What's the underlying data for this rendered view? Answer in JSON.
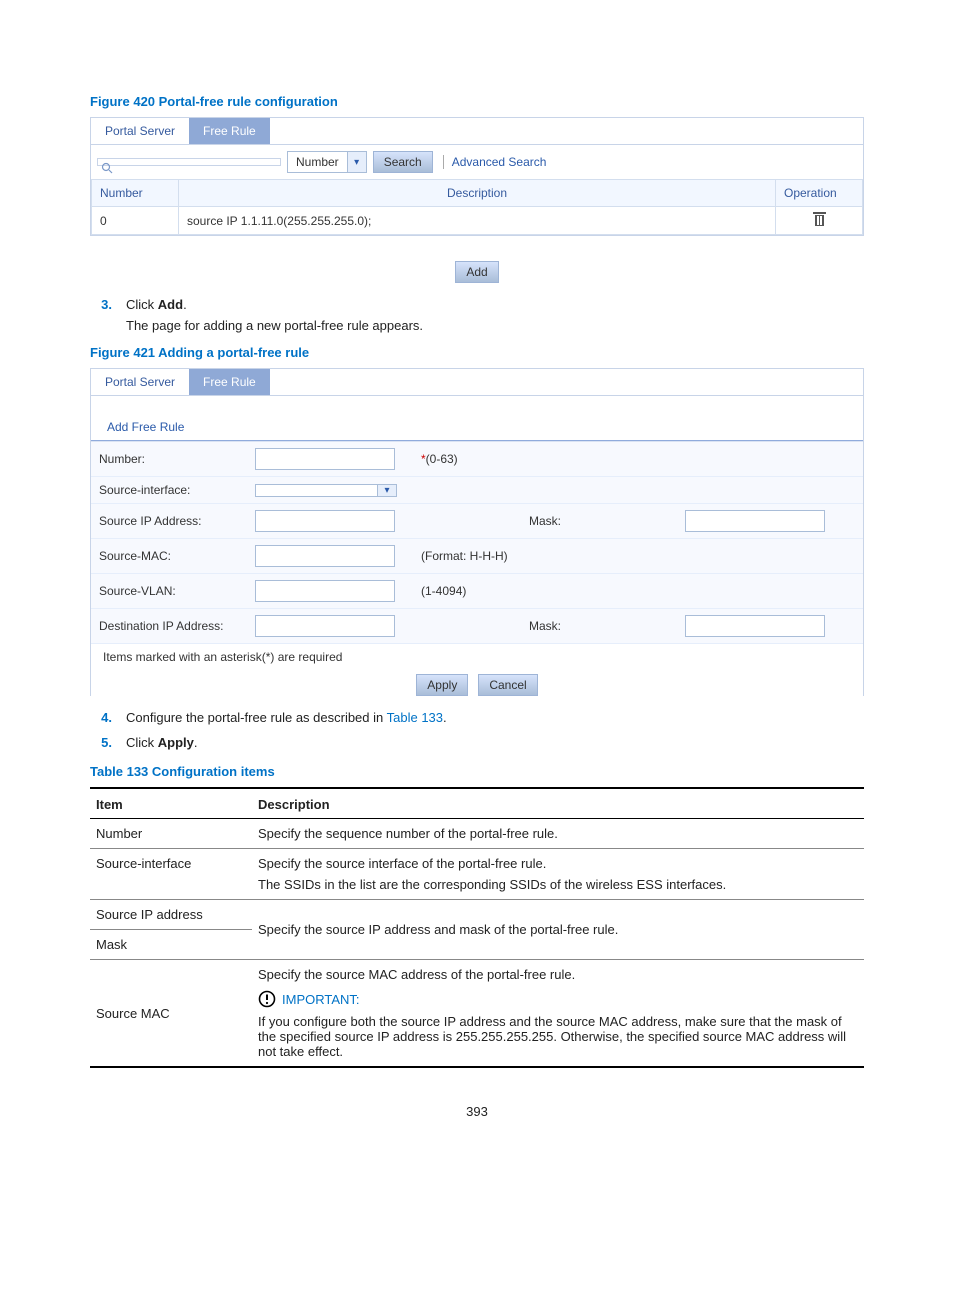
{
  "figure420": {
    "caption": "Figure 420 Portal-free rule configuration",
    "tabs": {
      "portal": "Portal Server",
      "freerule": "Free Rule"
    },
    "filterType": "Number",
    "searchBtn": "Search",
    "advSearch": "Advanced Search",
    "cols": {
      "number": "Number",
      "description": "Description",
      "operation": "Operation"
    },
    "row": {
      "number": "0",
      "description": "source IP 1.1.11.0(255.255.255.0);"
    },
    "addBtn": "Add"
  },
  "step3": {
    "num": "3.",
    "textA": "Click ",
    "textB": "Add",
    "textC": ".",
    "sub": "The page for adding a new portal-free rule appears."
  },
  "figure421": {
    "caption": "Figure 421 Adding a portal-free rule",
    "tabs": {
      "portal": "Portal Server",
      "freerule": "Free Rule"
    },
    "title": "Add Free Rule",
    "fields": {
      "number_label": "Number:",
      "number_hint": "(0-63)",
      "srcif_label": "Source-interface:",
      "srcip_label": "Source IP Address:",
      "mask_label": "Mask:",
      "srcmac_label": "Source-MAC:",
      "srcmac_hint": "(Format: H-H-H)",
      "srcvlan_label": "Source-VLAN:",
      "srcvlan_hint": "(1-4094)",
      "dstip_label": "Destination IP Address:"
    },
    "reqnote": "Items marked with an asterisk(*) are required",
    "applyBtn": "Apply",
    "cancelBtn": "Cancel"
  },
  "step4": {
    "num": "4.",
    "textA": "Configure the portal-free rule as described in ",
    "link": "Table 133",
    "textC": "."
  },
  "step5": {
    "num": "5.",
    "textA": "Click ",
    "textB": "Apply",
    "textC": "."
  },
  "table133": {
    "caption": "Table 133 Configuration items",
    "header": {
      "item": "Item",
      "desc": "Description"
    },
    "rows": {
      "number_item": "Number",
      "number_desc": "Specify the sequence number of the portal-free rule.",
      "srcif_item": "Source-interface",
      "srcif_desc1": "Specify the source interface of the portal-free rule.",
      "srcif_desc2": "The SSIDs in the list are the corresponding SSIDs of the wireless ESS interfaces.",
      "srcip_item": "Source IP address",
      "mask_item": "Mask",
      "srcip_mask_desc": "Specify the source IP address and mask of the portal-free rule.",
      "srcmac_item": "Source MAC",
      "srcmac_desc1": "Specify the source MAC address of the portal-free rule.",
      "important": "IMPORTANT:",
      "srcmac_desc2": "If you configure both the source IP address and the source MAC address, make sure that the mask of the specified source IP address is 255.255.255.255. Otherwise, the specified source MAC address will not take effect."
    }
  },
  "pagenum": "393"
}
